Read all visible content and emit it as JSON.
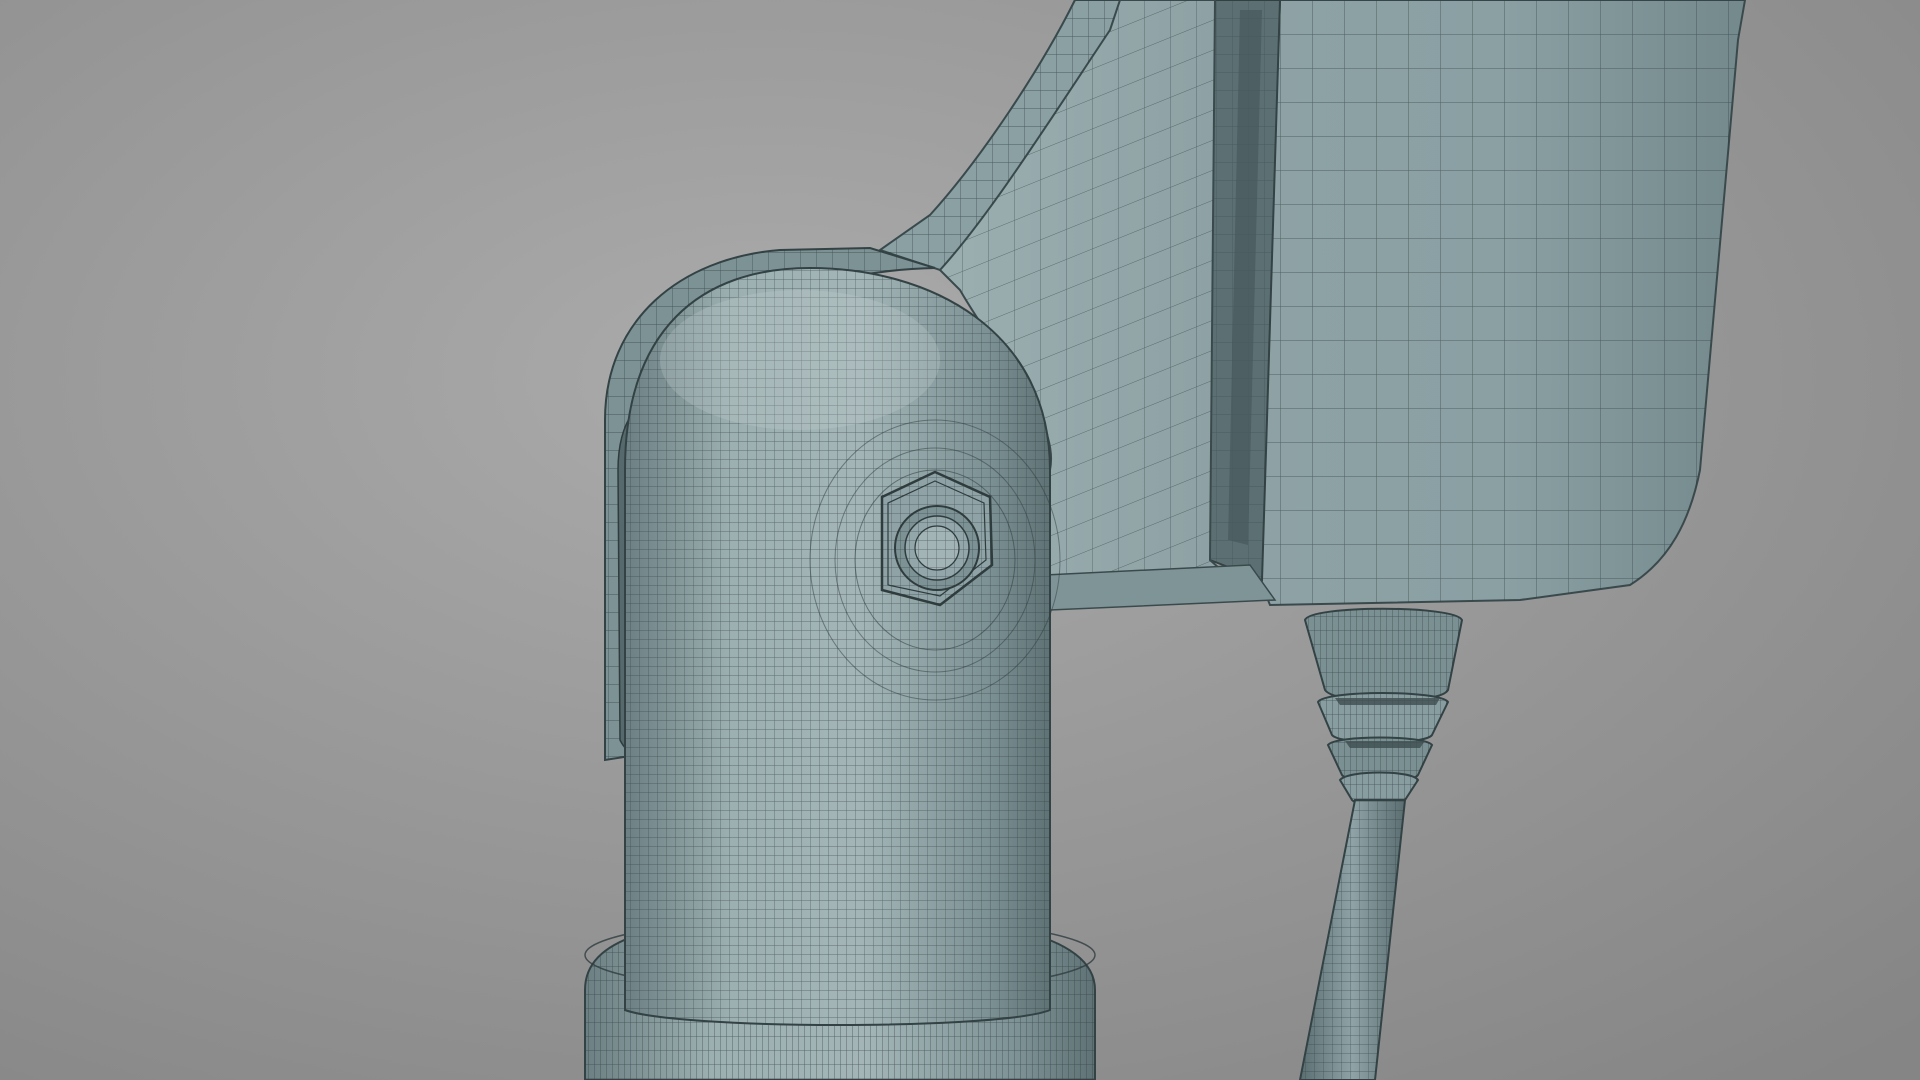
{
  "viewport": {
    "content": "3d-wireframe-render"
  },
  "colors": {
    "background_light": "#ababab",
    "background_dark": "#858585",
    "model_light": "#9eb1b3",
    "model_mid": "#7f9497",
    "model_dark": "#55686b",
    "wire": "#2f3c3e"
  },
  "objects": [
    {
      "name": "housing-panel"
    },
    {
      "name": "support-fin"
    },
    {
      "name": "clevis-bracket"
    },
    {
      "name": "rounded-post"
    },
    {
      "name": "hex-nut"
    },
    {
      "name": "bolt-head"
    },
    {
      "name": "post-collar"
    },
    {
      "name": "spring-coupling"
    },
    {
      "name": "cable"
    }
  ]
}
